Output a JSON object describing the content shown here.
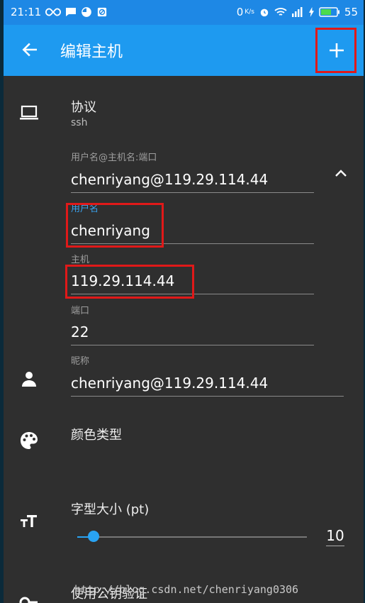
{
  "status": {
    "time": "21:11",
    "net_speed": "0",
    "net_unit": "K/s",
    "battery": "55"
  },
  "appbar": {
    "title": "编辑主机"
  },
  "protocol": {
    "label": "协议",
    "value": "ssh"
  },
  "connection": {
    "hint": "用户名@主机名:端口",
    "value": "chenriyang@119.29.114.44"
  },
  "username": {
    "hint": "用户名",
    "value": "chenriyang"
  },
  "host": {
    "hint": "主机",
    "value": "119.29.114.44"
  },
  "port": {
    "hint": "端口",
    "value": "22"
  },
  "nickname": {
    "hint": "昵称",
    "value": "chenriyang@119.29.114.44"
  },
  "color": {
    "label": "颜色类型"
  },
  "font_size": {
    "label": "字型大小 (pt)",
    "value": "10",
    "slider_fraction": 0.07
  },
  "pubkey": {
    "label": "使用公钥验证"
  },
  "watermark": "http://blog.csdn.net/chenriyang0306",
  "colors": {
    "appbar": "#1e9af0",
    "statusbar": "#1e88e5",
    "background": "#2f2f2f",
    "accent": "#29a3f3",
    "highlight_box": "#e01919"
  }
}
